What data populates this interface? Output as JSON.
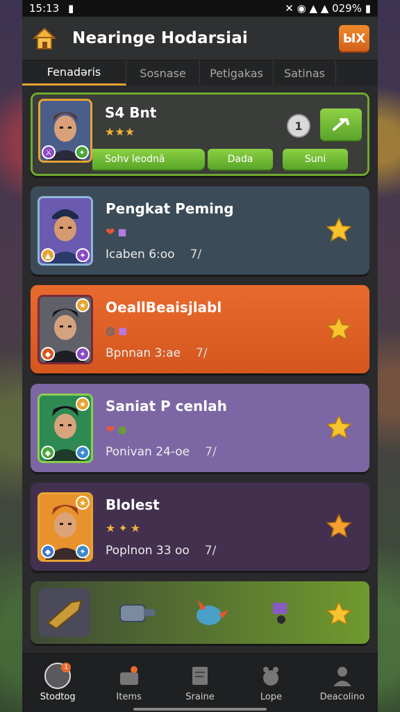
{
  "status_bar": {
    "time": "15:13",
    "battery": "029%"
  },
  "header": {
    "title": "Nearinge Hodarsiai",
    "close_label": "ЫХ"
  },
  "tabs": [
    {
      "label": "Fenadəris"
    },
    {
      "label": "Sosnase"
    },
    {
      "label": "Petigakas"
    },
    {
      "label": "Satinas"
    }
  ],
  "featured": {
    "name": "S4 Bnt",
    "stars": "★★★",
    "primary_pill": "Sohv leodnä",
    "count": "1",
    "pill_a": "Dada",
    "pill_b": "Suni"
  },
  "cards": [
    {
      "name": "Pengkat Peming",
      "sub": "Icaben 6:oo",
      "arrow": "7/"
    },
    {
      "name": "OeallBeaisjlabl",
      "sub": "Bpnnan 3:ae",
      "arrow": "7/"
    },
    {
      "name": "Saniat P cenlah",
      "sub": "Ponivan 24-oe",
      "arrow": "7/"
    },
    {
      "name": "Blolest",
      "sub": "Poplnon 33 oo",
      "arrow": "7/"
    }
  ],
  "bottom_nav": [
    {
      "label": "Stodtog",
      "badge": "1"
    },
    {
      "label": "Items"
    },
    {
      "label": "Sraine"
    },
    {
      "label": "Lope"
    },
    {
      "label": "Deacolino"
    }
  ],
  "colors": {
    "accent": "#e7a431",
    "orange_card": "#e86a2e",
    "lavender_card": "#7c67a4",
    "purple_card": "#43304f",
    "slate_card": "#3b4b57",
    "green": "#6faa2e"
  }
}
